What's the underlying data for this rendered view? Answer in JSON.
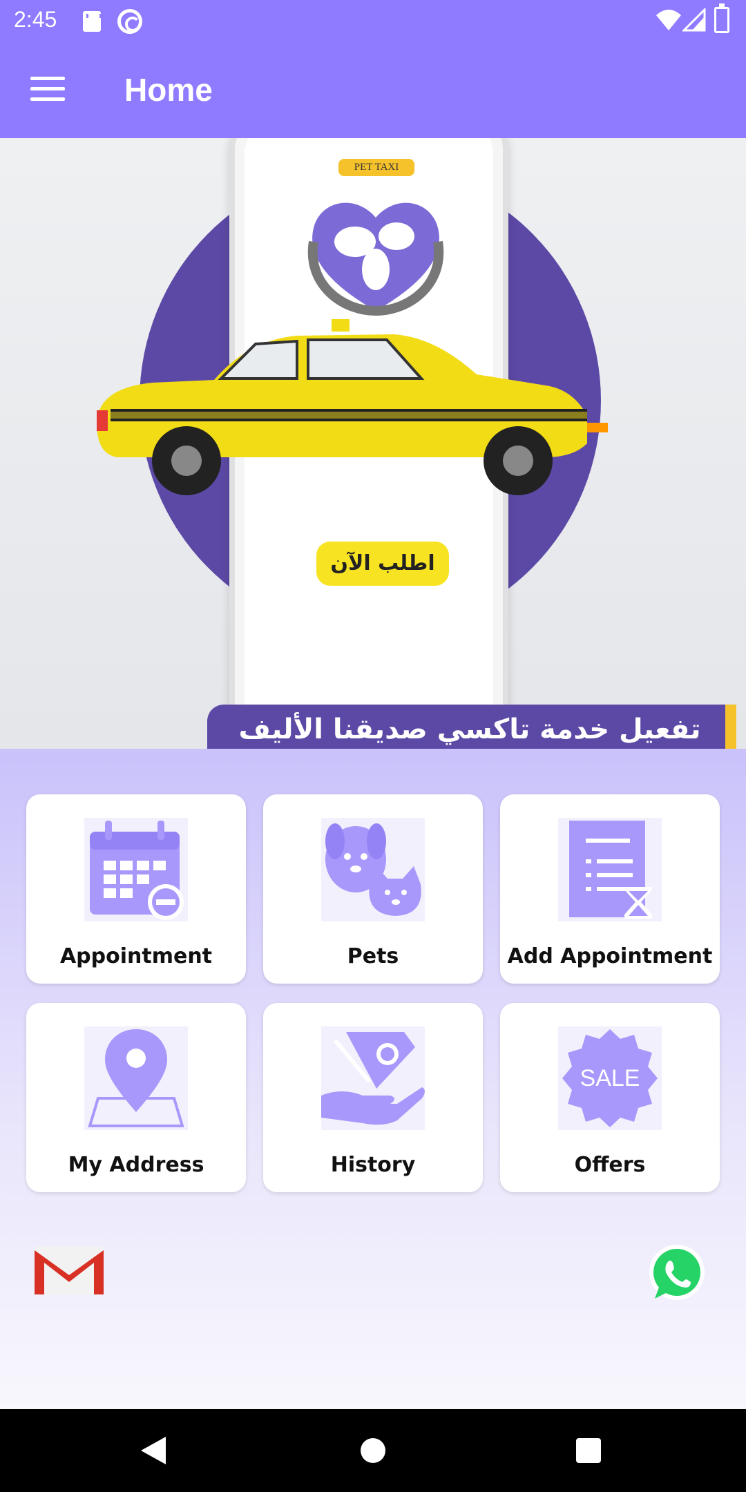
{
  "status_bar": {
    "time": "2:45"
  },
  "app_bar": {
    "title": "Home"
  },
  "banner": {
    "logo_text": "PET TAXI",
    "order_button": "اطلب الآن",
    "caption": "تفعيل خدمة تاكسي صديقنا الأليف"
  },
  "tiles": [
    {
      "label": "Appointment",
      "icon": "calendar-remove-icon"
    },
    {
      "label": "Pets",
      "icon": "dog-cat-icon"
    },
    {
      "label": "Add Appointment",
      "icon": "document-hourglass-icon"
    },
    {
      "label": "My Address",
      "icon": "map-pin-icon"
    },
    {
      "label": "History",
      "icon": "hand-money-icon"
    },
    {
      "label": "Offers",
      "icon": "sale-badge-icon"
    }
  ],
  "sale_badge_text": "SALE",
  "contacts": {
    "gmail": "gmail-icon",
    "whatsapp": "whatsapp-icon"
  },
  "colors": {
    "primary": "#8f7bff",
    "accent_purple": "#5c49a6",
    "icon_purple": "#a898fb",
    "taxi_yellow": "#f7e321"
  }
}
